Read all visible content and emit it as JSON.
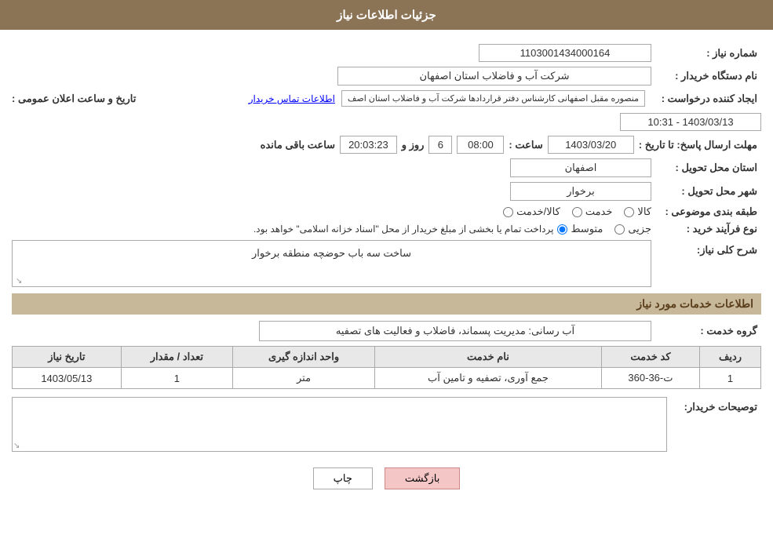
{
  "header": {
    "title": "جزئیات اطلاعات نیاز"
  },
  "fields": {
    "shomareNiaz_label": "شماره نیاز :",
    "shomareNiaz_value": "1103001434000164",
    "namDastgah_label": "نام دستگاه خریدار :",
    "namDastgah_value": "شرکت آب و فاضلاب استان اصفهان",
    "ijadKonande_label": "ایجاد کننده درخواست :",
    "ijadKonande_value": "منصوره مقبل اصفهانی کارشناس دفتر قراردادها شرکت آب و فاضلاب استان اصف",
    "ijadKonande_link": "اطلاعات تماس خریدار",
    "mohlatIrsalPasokh_label": "مهلت ارسال پاسخ: تا تاریخ :",
    "date_value": "1403/03/20",
    "saat_label": "ساعت :",
    "saat_value": "08:00",
    "roz_label": "روز و",
    "roz_value": "6",
    "countdown_label": "ساعت باقی مانده",
    "countdown_value": "20:03:23",
    "tarikhSaatElam_label": "تاریخ و ساعت اعلان عمومی :",
    "tarikhSaatElam_value": "1403/03/13 - 10:31",
    "ostanTahvil_label": "استان محل تحویل :",
    "ostanTahvil_value": "اصفهان",
    "shahrTahvil_label": "شهر محل تحویل :",
    "shahrTahvil_value": "برخوار",
    "tabaqeBandi_label": "طبقه بندی موضوعی :",
    "kala_label": "کالا",
    "khedmat_label": "خدمت",
    "kala_khedmat_label": "کالا/خدمت",
    "noFarayand_label": "نوع فرآیند خرید :",
    "jozee_label": "جزیی",
    "motavasset_label": "متوسط",
    "note_text": "پرداخت تمام یا بخشی از مبلغ خریدار از محل \"اسناد خزانه اسلامی\" خواهد بود.",
    "sharhKolliNiaz_label": "شرح کلی نیاز:",
    "sharhKolliNiaz_value": "ساخت سه باب حوضچه منطقه برخوار",
    "khadamat_section": "اطلاعات خدمات مورد نیاز",
    "groheKhedmat_label": "گروه خدمت :",
    "groheKhedmat_value": "آب رسانی: مدیریت پسماند، فاضلاب و فعالیت های تصفیه",
    "table": {
      "headers": [
        "ردیف",
        "کد خدمت",
        "نام خدمت",
        "واحد اندازه گیری",
        "تعداد / مقدار",
        "تاریخ نیاز"
      ],
      "rows": [
        {
          "radif": "1",
          "kodKhedmat": "ت-36-360",
          "namKhedmat": "جمع آوری، تصفیه و تامین آب",
          "vahed": "متر",
          "tedad": "1",
          "tarikh": "1403/05/13"
        }
      ]
    },
    "tosifatKharidar_label": "توصیحات خریدار:",
    "tosifatKharidar_value": ""
  },
  "buttons": {
    "print_label": "چاپ",
    "back_label": "بازگشت"
  }
}
